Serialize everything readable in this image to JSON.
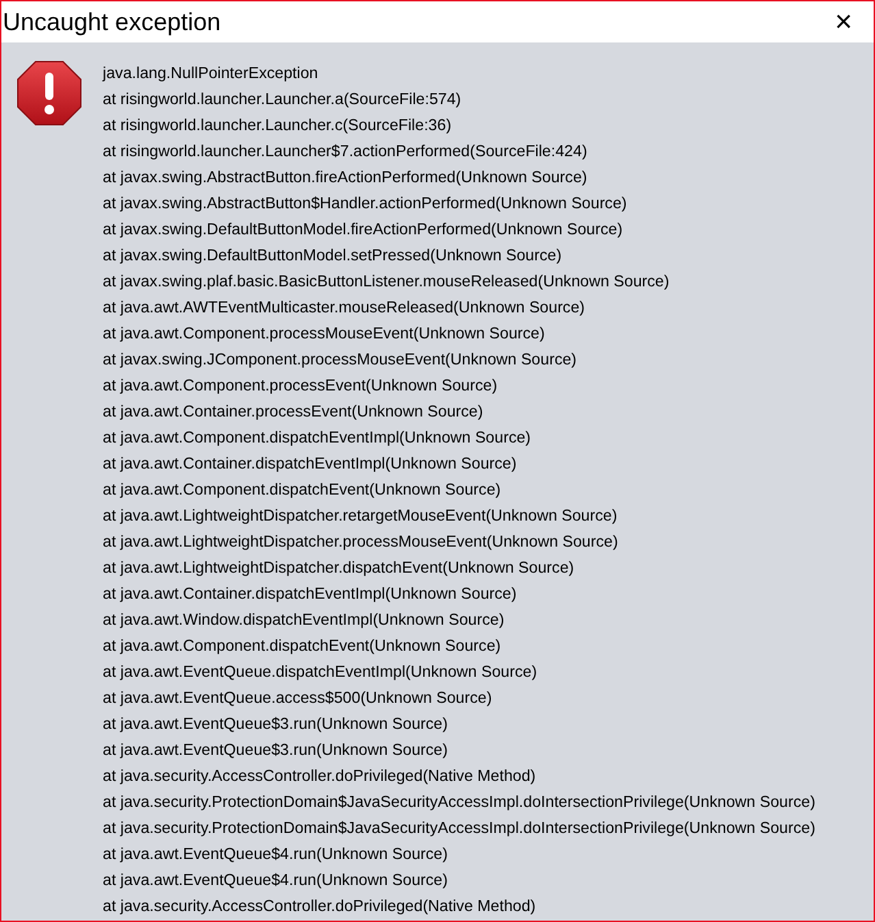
{
  "window": {
    "title": "Uncaught exception",
    "close": "×"
  },
  "message": {
    "lines": [
      "java.lang.NullPointerException",
      "at risingworld.launcher.Launcher.a(SourceFile:574)",
      "at risingworld.launcher.Launcher.c(SourceFile:36)",
      "at risingworld.launcher.Launcher$7.actionPerformed(SourceFile:424)",
      "at javax.swing.AbstractButton.fireActionPerformed(Unknown Source)",
      "at javax.swing.AbstractButton$Handler.actionPerformed(Unknown Source)",
      "at javax.swing.DefaultButtonModel.fireActionPerformed(Unknown Source)",
      "at javax.swing.DefaultButtonModel.setPressed(Unknown Source)",
      "at javax.swing.plaf.basic.BasicButtonListener.mouseReleased(Unknown Source)",
      "at java.awt.AWTEventMulticaster.mouseReleased(Unknown Source)",
      "at java.awt.Component.processMouseEvent(Unknown Source)",
      "at javax.swing.JComponent.processMouseEvent(Unknown Source)",
      "at java.awt.Component.processEvent(Unknown Source)",
      "at java.awt.Container.processEvent(Unknown Source)",
      "at java.awt.Component.dispatchEventImpl(Unknown Source)",
      "at java.awt.Container.dispatchEventImpl(Unknown Source)",
      "at java.awt.Component.dispatchEvent(Unknown Source)",
      "at java.awt.LightweightDispatcher.retargetMouseEvent(Unknown Source)",
      "at java.awt.LightweightDispatcher.processMouseEvent(Unknown Source)",
      "at java.awt.LightweightDispatcher.dispatchEvent(Unknown Source)",
      "at java.awt.Container.dispatchEventImpl(Unknown Source)",
      "at java.awt.Window.dispatchEventImpl(Unknown Source)",
      "at java.awt.Component.dispatchEvent(Unknown Source)",
      "at java.awt.EventQueue.dispatchEventImpl(Unknown Source)",
      "at java.awt.EventQueue.access$500(Unknown Source)",
      "at java.awt.EventQueue$3.run(Unknown Source)",
      "at java.awt.EventQueue$3.run(Unknown Source)",
      "at java.security.AccessController.doPrivileged(Native Method)",
      "at java.security.ProtectionDomain$JavaSecurityAccessImpl.doIntersectionPrivilege(Unknown Source)",
      "at java.security.ProtectionDomain$JavaSecurityAccessImpl.doIntersectionPrivilege(Unknown Source)",
      "at java.awt.EventQueue$4.run(Unknown Source)",
      "at java.awt.EventQueue$4.run(Unknown Source)",
      "at java.security.AccessController.doPrivileged(Native Method)"
    ]
  }
}
